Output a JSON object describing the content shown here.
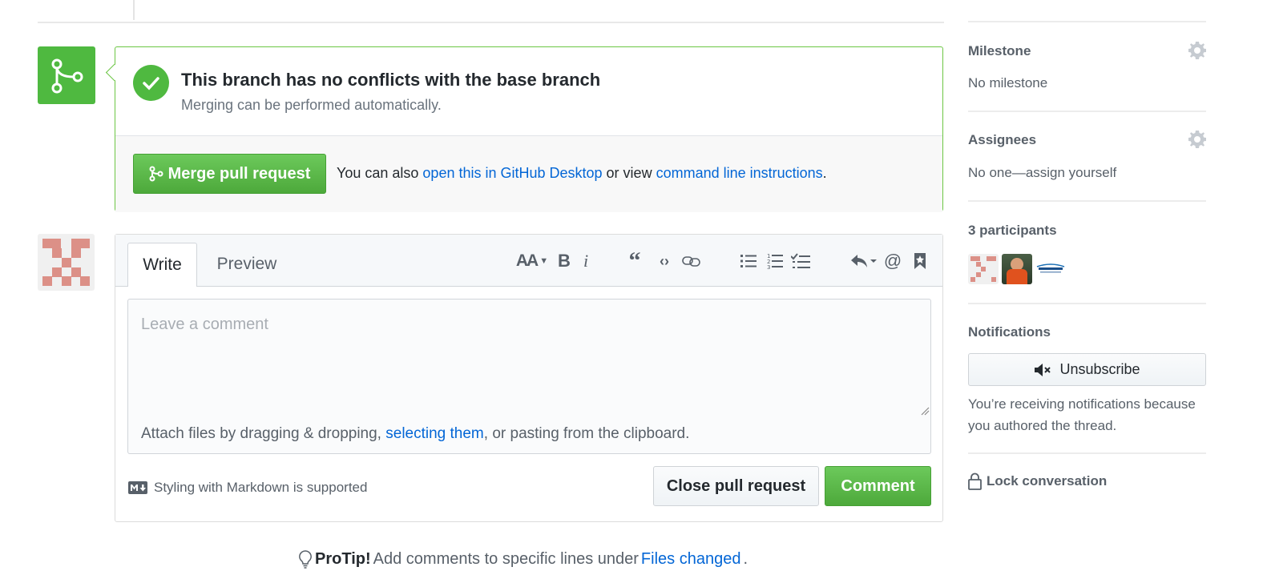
{
  "merge": {
    "title": "This branch has no conflicts with the base branch",
    "subtitle": "Merging can be performed automatically.",
    "button_label": "Merge pull request",
    "also_text": "You can also ",
    "desktop_link": "open this in GitHub Desktop",
    "or_view": " or view ",
    "cli_link": "command line instructions",
    "period": "."
  },
  "comment": {
    "tabs": {
      "write": "Write",
      "preview": "Preview"
    },
    "toolbar": [
      "header",
      "bold",
      "italic",
      "quote",
      "code",
      "link",
      "unordered-list",
      "ordered-list",
      "task-list",
      "reply",
      "mention",
      "saved-reply"
    ],
    "placeholder": "Leave a comment",
    "attach_prefix": "Attach files by dragging & dropping, ",
    "attach_link": "selecting them",
    "attach_suffix": ", or pasting from the clipboard.",
    "markdown_note": "Styling with Markdown is supported",
    "close_label": "Close pull request",
    "comment_label": "Comment"
  },
  "protip": {
    "bold": "ProTip!",
    "text": " Add comments to specific lines under ",
    "link": "Files changed",
    "period": "."
  },
  "sidebar": {
    "milestone": {
      "heading": "Milestone",
      "value": "No milestone"
    },
    "assignees": {
      "heading": "Assignees",
      "value": "No one—assign yourself"
    },
    "participants": {
      "heading": "3 participants"
    },
    "notifications": {
      "heading": "Notifications",
      "button": "Unsubscribe",
      "reason": "You’re receiving notifications because you authored the thread."
    },
    "lock": "Lock conversation"
  },
  "colors": {
    "success": "#4fb940",
    "link": "#0366d6",
    "avatar": "#dc9087"
  }
}
